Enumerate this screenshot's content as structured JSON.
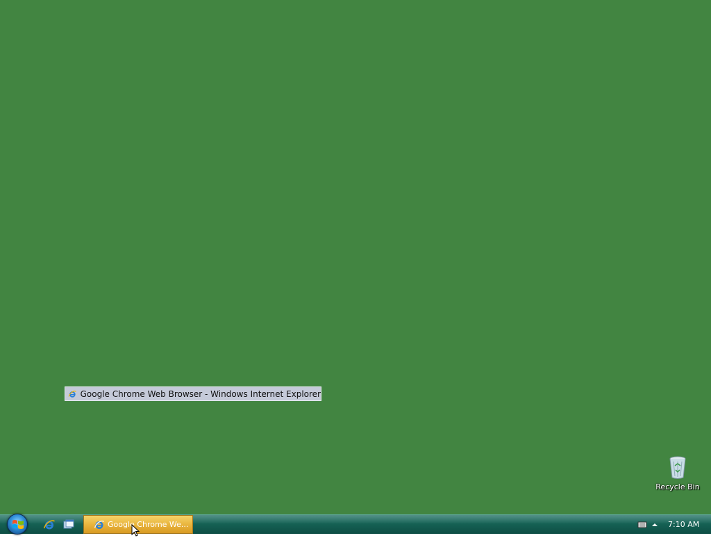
{
  "desktop": {
    "background_color": "#428541",
    "drag_tooltip": {
      "label": "Google Chrome Web Browser - Windows Internet Explorer",
      "icon": "internet-explorer-icon"
    },
    "recycle_bin": {
      "label": "Recycle Bin",
      "icon": "recycle-bin-icon"
    }
  },
  "taskbar": {
    "start_icon": "windows-logo-icon",
    "quick_launch": [
      {
        "icon": "internet-explorer-icon"
      },
      {
        "icon": "switch-windows-icon"
      }
    ],
    "active_task": {
      "label": "Google Chrome We...",
      "icon": "internet-explorer-icon"
    },
    "tray": {
      "icons": [
        "network-icon",
        "show-hidden-icons-chevron"
      ],
      "clock": "7:10 AM"
    }
  }
}
